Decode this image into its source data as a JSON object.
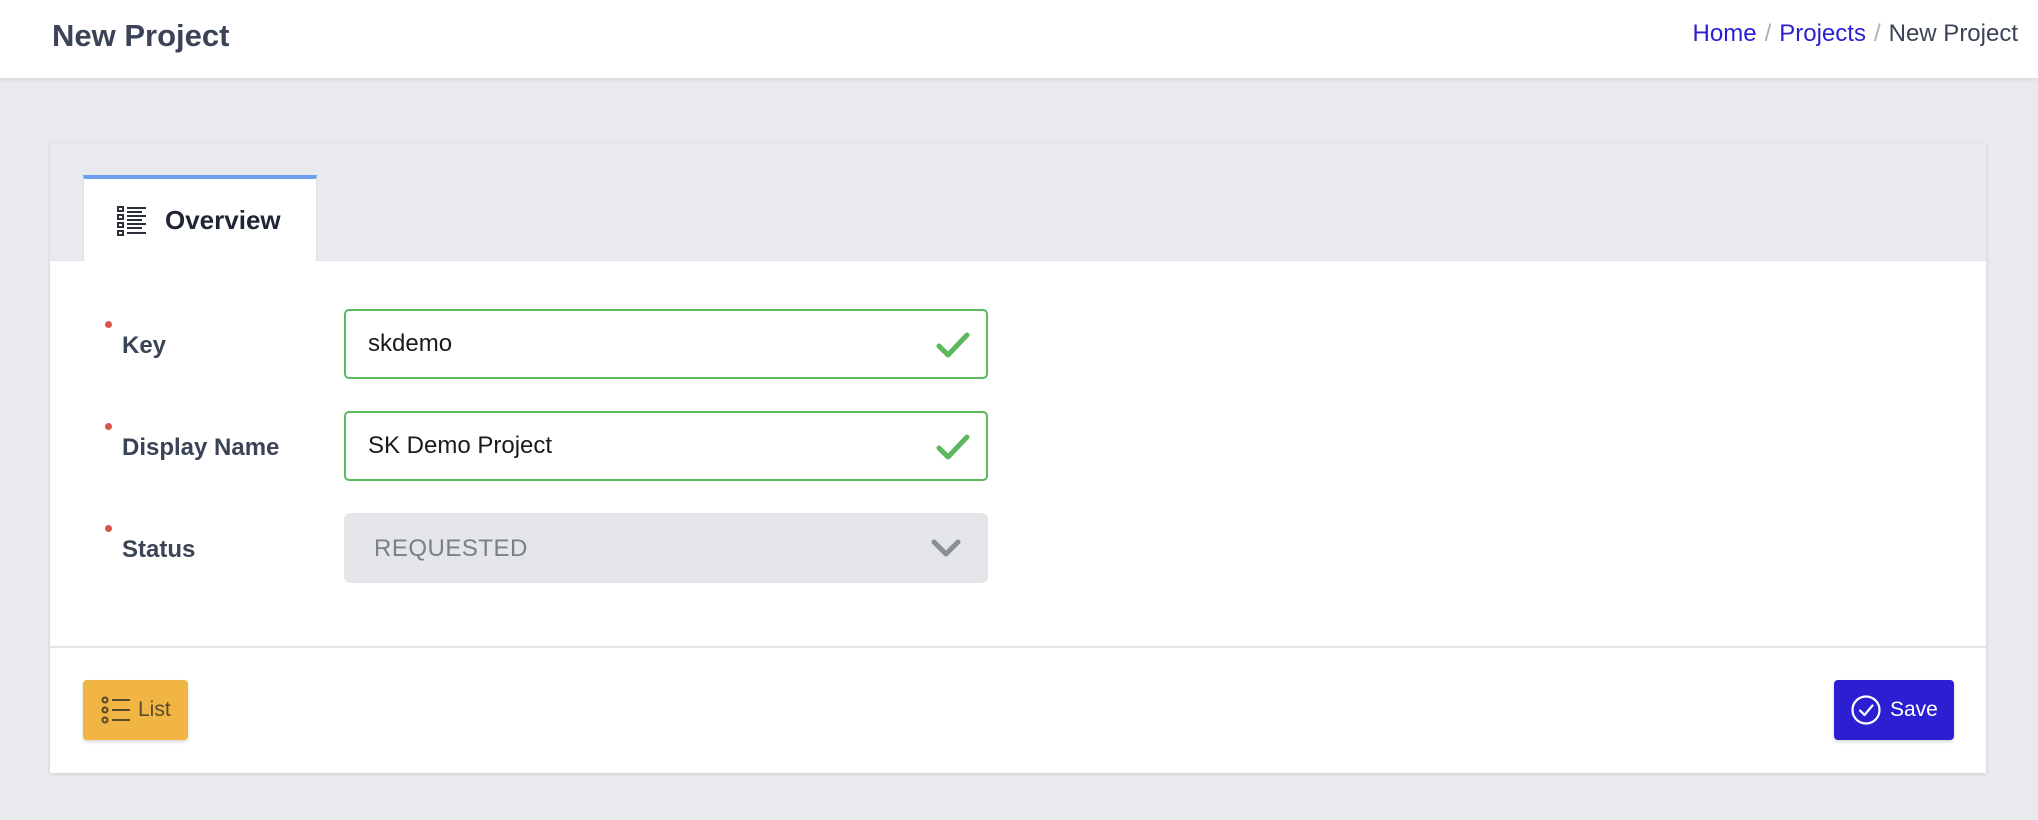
{
  "header": {
    "title": "New Project",
    "breadcrumb": [
      {
        "label": "Home"
      },
      {
        "label": "Projects"
      },
      {
        "label": "New Project"
      }
    ],
    "separator": "/"
  },
  "tabs": [
    {
      "label": "Overview",
      "icon": "list-icon",
      "active": true
    }
  ],
  "form": {
    "fields": [
      {
        "label": "Key",
        "value": "skdemo",
        "required": true,
        "valid": true
      },
      {
        "label": "Display Name",
        "value": "SK Demo Project",
        "required": true,
        "valid": true
      },
      {
        "label": "Status",
        "value": "REQUESTED",
        "required": true,
        "type": "select",
        "disabled": true
      }
    ]
  },
  "footer": {
    "list_label": "List",
    "save_label": "Save"
  },
  "colors": {
    "accent": "#2b1fd1",
    "valid": "#5cb85c",
    "required": "#d9534f",
    "list_button": "#f0b543",
    "tab_indicator": "#6c9ff0"
  }
}
